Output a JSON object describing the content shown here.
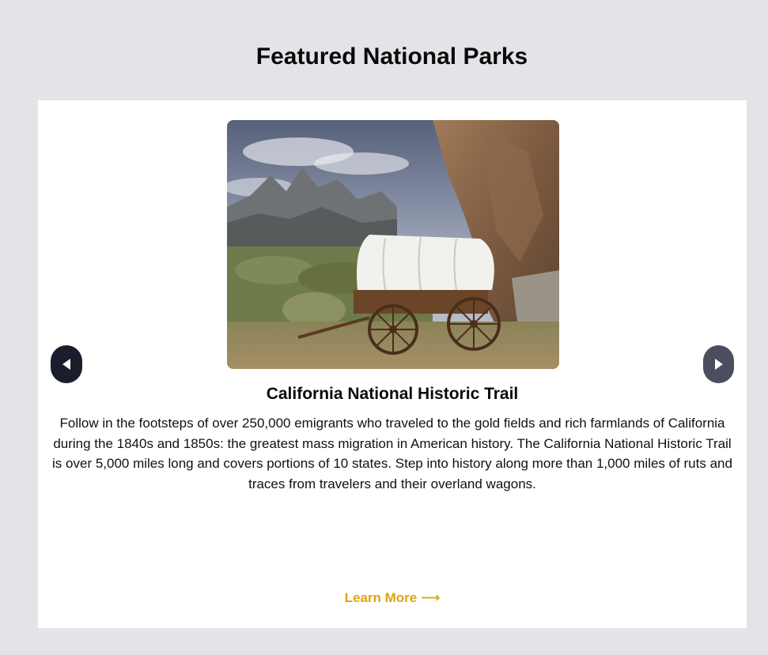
{
  "section": {
    "title": "Featured National Parks"
  },
  "carousel": {
    "prev_icon": "triangle-left-icon",
    "next_icon": "triangle-right-icon",
    "slide": {
      "title": "California National Historic Trail",
      "description": "Follow in the footsteps of over 250,000 emigrants who traveled to the gold fields and rich farmlands of California during the 1840s and 1850s: the greatest mass migration in American history. The California National Historic Trail is over 5,000 miles long and covers portions of 10 states. Step into history along more than 1,000 miles of ruts and traces from travelers and their overland wagons.",
      "cta_label": "Learn More ⟶"
    }
  },
  "colors": {
    "page_background": "#e3e4e8",
    "card_background": "#ffffff",
    "prev_button": "#1a1d2b",
    "next_button": "#4a4e5e",
    "link_accent": "#dba514"
  }
}
